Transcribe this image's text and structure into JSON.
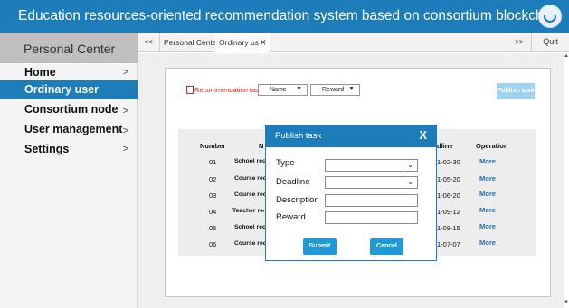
{
  "header": {
    "title": "Education resources-oriented recommendation system based on consortium blockchain",
    "logo_icon": "blockchain-logo-icon"
  },
  "sidebar": {
    "title": "Personal Center",
    "items": [
      {
        "label": "Home",
        "chevron": ">"
      },
      {
        "label": "Ordinary user",
        "chevron": ""
      },
      {
        "label": "Consortium node",
        "chevron": ">"
      },
      {
        "label": "User management",
        "chevron": ">"
      },
      {
        "label": "Settings",
        "chevron": ">"
      }
    ],
    "active_index": 1
  },
  "tabbar": {
    "prev": "<<",
    "next": ">>",
    "quit": "Quit",
    "tabs": [
      {
        "label": "Personal Center",
        "close": ""
      },
      {
        "label": "Ordinary us",
        "close": "✕"
      }
    ]
  },
  "toolbar": {
    "recommendation_label": "Recommendation tasks",
    "name_select": "Name",
    "reward_select": "Reward",
    "caret": "▼",
    "publish_button": "Publish task"
  },
  "table": {
    "headers": {
      "number": "Number",
      "name": "N",
      "deadline": "dline",
      "operation": "Operation"
    },
    "rows": [
      {
        "number": "01",
        "name": "School reco",
        "deadline": "1-02-30",
        "operation": "More"
      },
      {
        "number": "02",
        "name": "Course reco",
        "deadline": "1-05-20",
        "operation": "More"
      },
      {
        "number": "03",
        "name": "Course reco",
        "deadline": "1-06-20",
        "operation": "More"
      },
      {
        "number": "04",
        "name": "Teacher reco",
        "deadline": "1-09-12",
        "operation": "More"
      },
      {
        "number": "05",
        "name": "School reco",
        "deadline": "1-08-15",
        "operation": "More"
      },
      {
        "number": "06",
        "name": "Course reco",
        "deadline": "1-07-07",
        "operation": "More"
      }
    ]
  },
  "modal": {
    "title": "Publish task",
    "close": "X",
    "fields": {
      "type_label": "Type",
      "type_value": "",
      "deadline_label": "Deadline",
      "deadline_value": "",
      "description_label": "Description",
      "description_value": "",
      "reward_label": "Reward",
      "reward_value": ""
    },
    "dropdown_caret": "⌄",
    "submit": "Submit",
    "cancel": "Cancel"
  },
  "colors": {
    "brand": "#1d7cba",
    "sidebar_active": "#1d7cba",
    "publish_button": "#9fd3f2",
    "modal_button": "#1e9ad6",
    "link": "#1e6fbf",
    "warning_label": "#dd2222"
  }
}
